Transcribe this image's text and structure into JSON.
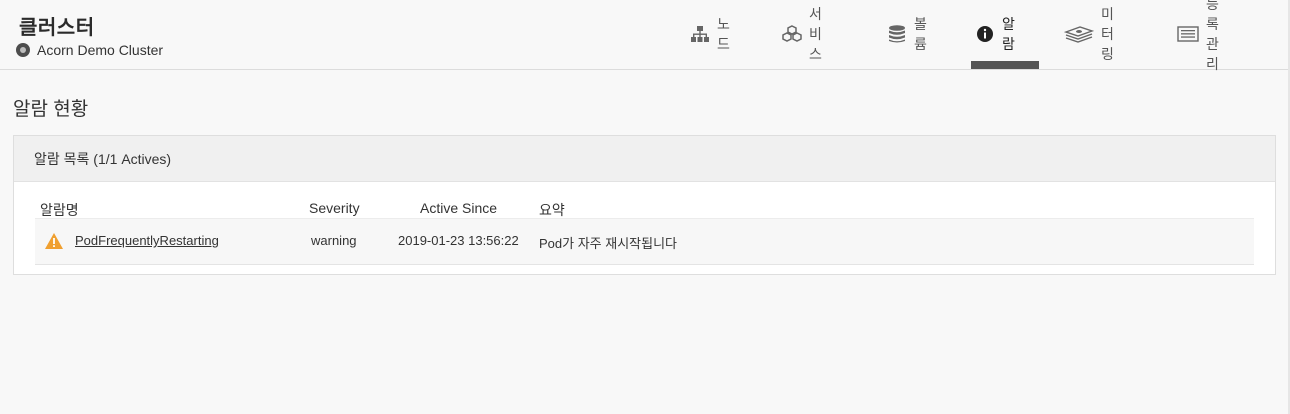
{
  "header": {
    "title": "클러스터",
    "cluster_name": "Acorn Demo Cluster"
  },
  "nav": {
    "items": [
      {
        "label": "노드",
        "icon": "node-tree-icon"
      },
      {
        "label": "서비스",
        "icon": "cubes-icon"
      },
      {
        "label": "볼륨",
        "icon": "database-icon"
      },
      {
        "label": "알람",
        "icon": "info-icon",
        "active": true
      },
      {
        "label": "미터링",
        "icon": "money-stack-icon"
      },
      {
        "label": "등록관리",
        "icon": "list-icon"
      }
    ]
  },
  "main": {
    "section_title": "알람 현황",
    "panel_title": "알람 목록 (1/1 Actives)",
    "table": {
      "columns": [
        "알람명",
        "Severity",
        "Active Since",
        "요약"
      ],
      "rows": [
        {
          "name": "PodFrequentlyRestarting",
          "severity": "warning",
          "active_since": "2019-01-23 13:56:22",
          "summary": "Pod가 자주 재시작됩니다"
        }
      ]
    }
  },
  "colors": {
    "warning": "#f0a030",
    "active_tab": "#555555"
  }
}
